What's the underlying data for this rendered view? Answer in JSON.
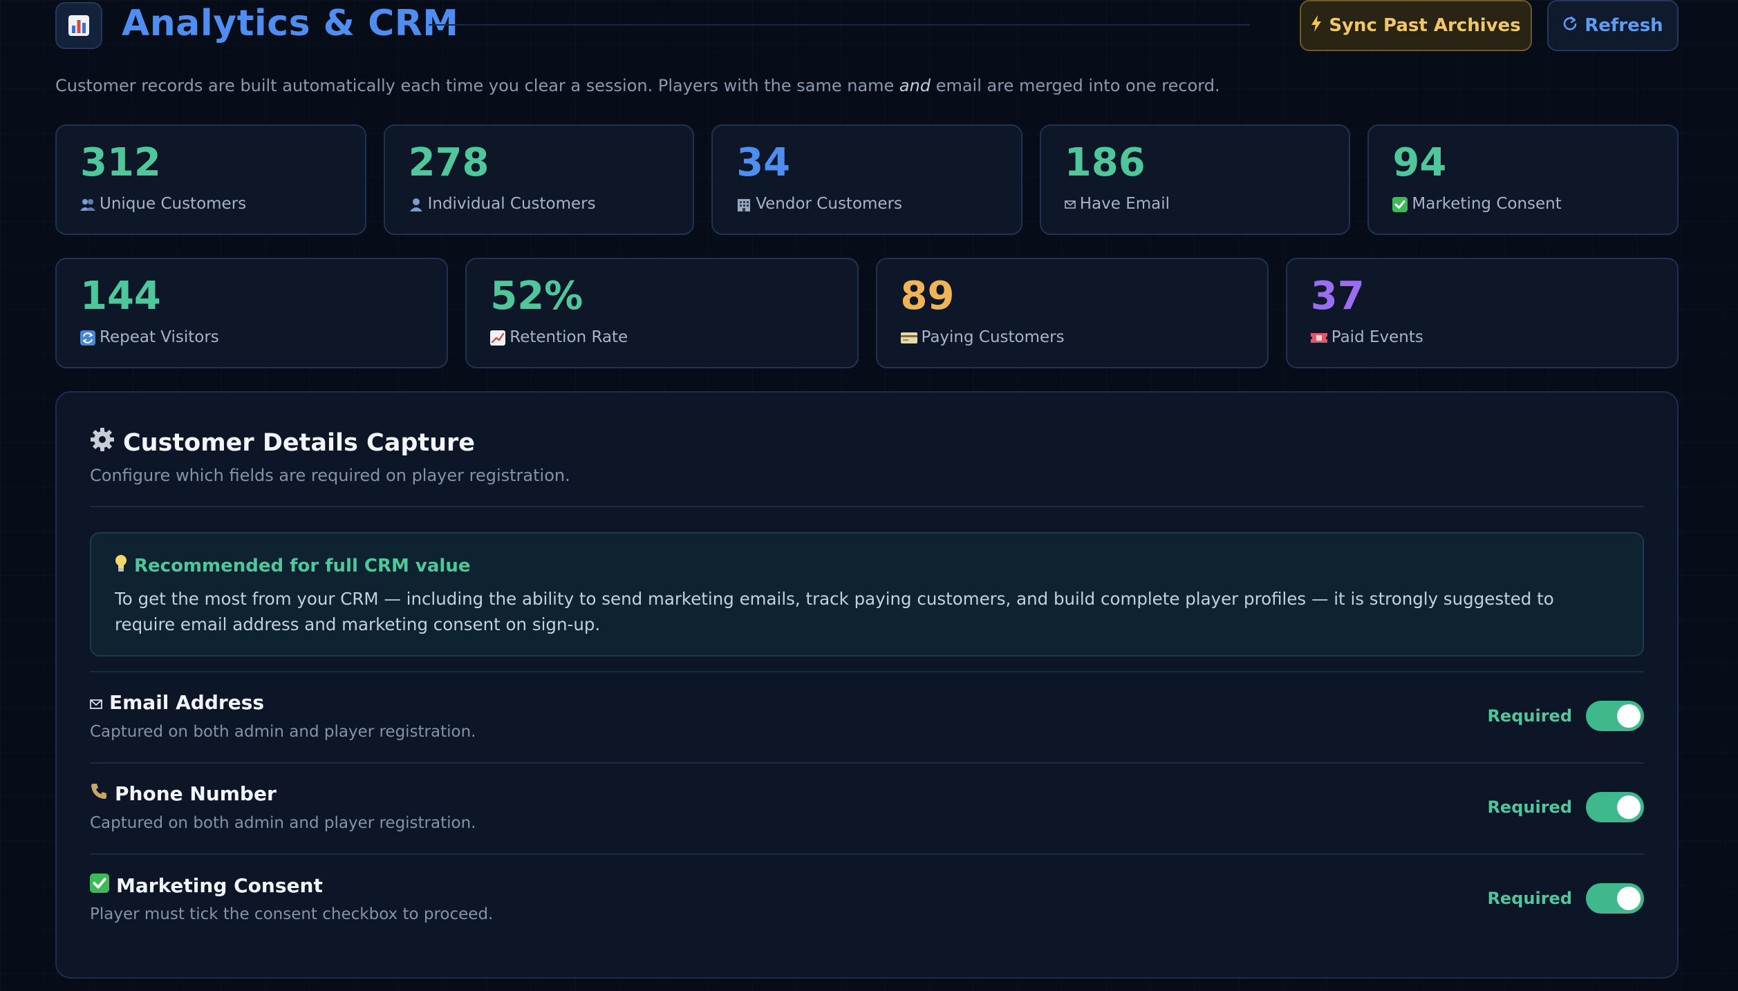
{
  "header": {
    "title": "Analytics & CRM",
    "logo_icon": "bar-chart-icon",
    "sync_label": "Sync Past Archives",
    "refresh_label": "Refresh",
    "subtitle_part1": "Customer records are built automatically each time you clear a session. Players with the same name ",
    "subtitle_em": "and",
    "subtitle_part2": " email are merged into one record."
  },
  "stats_row1": [
    {
      "value": "312",
      "label": "Unique Customers",
      "icon": "people-icon",
      "color": "#4fc79a"
    },
    {
      "value": "278",
      "label": "Individual Customers",
      "icon": "person-icon",
      "color": "#4fc79a"
    },
    {
      "value": "34",
      "label": "Vendor Customers",
      "icon": "building-icon",
      "color": "#4f8ef0"
    },
    {
      "value": "186",
      "label": "Have Email",
      "icon": "envelope-icon",
      "color": "#4fc79a"
    },
    {
      "value": "94",
      "label": "Marketing Consent",
      "icon": "check-icon",
      "color": "#4fc79a"
    }
  ],
  "stats_row2": [
    {
      "value": "144",
      "label": "Repeat Visitors",
      "icon": "repeat-icon",
      "color": "#4fc79a"
    },
    {
      "value": "52%",
      "label": "Retention Rate",
      "icon": "trend-up-icon",
      "color": "#4fc79a"
    },
    {
      "value": "89",
      "label": "Paying Customers",
      "icon": "credit-card-icon",
      "color": "#f0b458"
    },
    {
      "value": "37",
      "label": "Paid Events",
      "icon": "ticket-icon",
      "color": "#9b6df0"
    }
  ],
  "capture": {
    "title": "Customer Details Capture",
    "subtitle": "Configure which fields are required on player registration.",
    "recommend_title": "Recommended for full CRM value",
    "recommend_body": "To get the most from your CRM — including the ability to send marketing emails, track paying customers, and build complete player profiles — it is strongly suggested to require email address and marketing consent on sign-up.",
    "fields": [
      {
        "name": "Email Address",
        "desc": "Captured on both admin and player registration.",
        "status": "Required",
        "on": true,
        "icon": "envelope-icon"
      },
      {
        "name": "Phone Number",
        "desc": "Captured on both admin and player registration.",
        "status": "Required",
        "on": true,
        "icon": "phone-icon"
      },
      {
        "name": "Marketing Consent",
        "desc": "Player must tick the consent checkbox to proceed.",
        "status": "Required",
        "on": true,
        "icon": "check-icon"
      }
    ]
  }
}
